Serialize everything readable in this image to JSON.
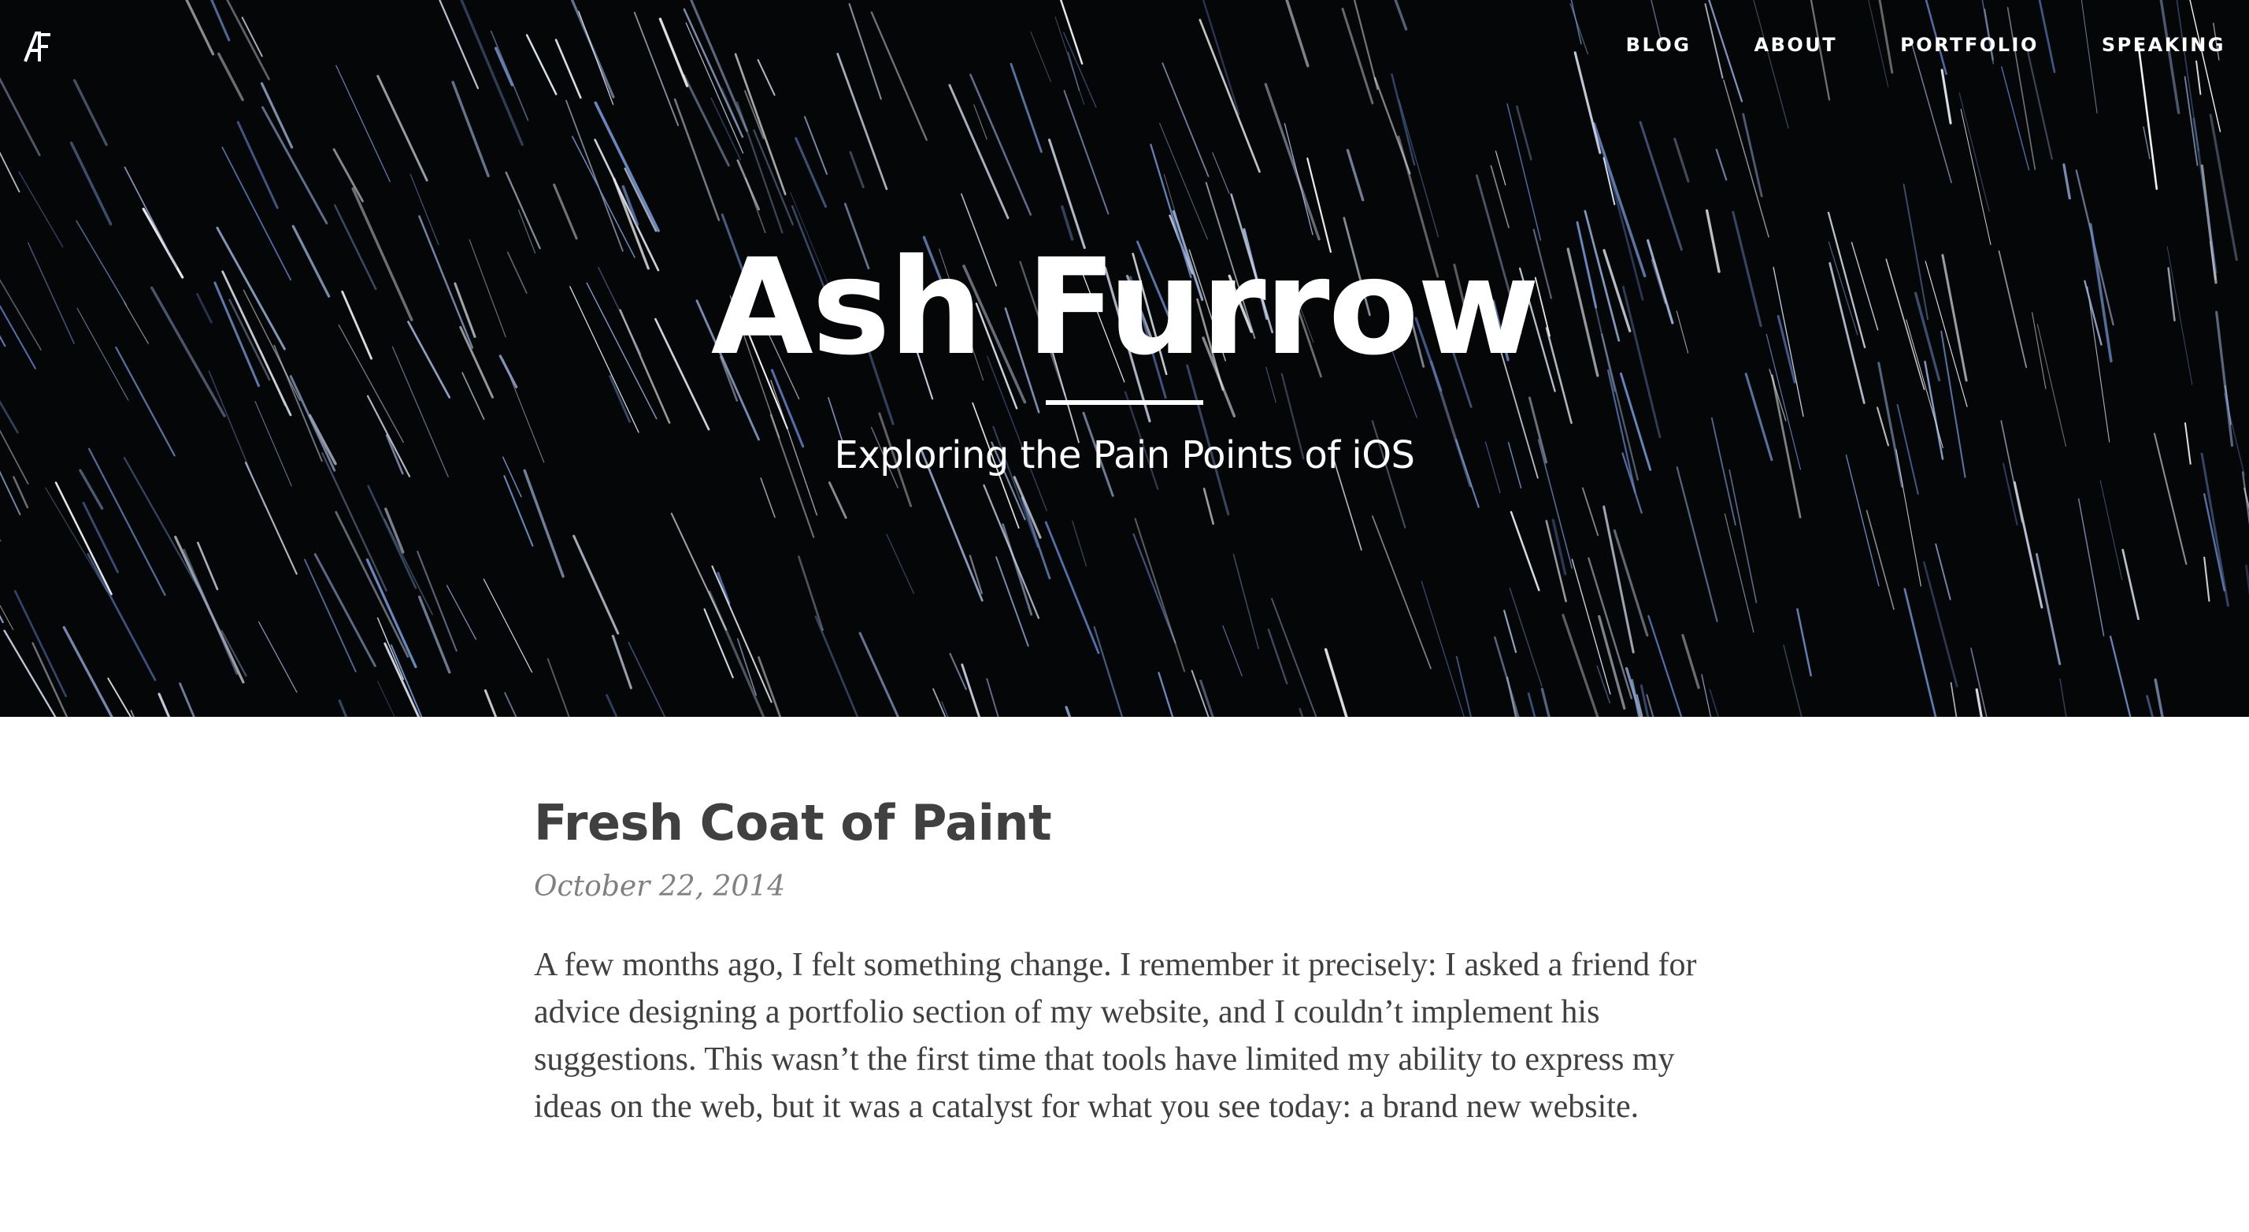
{
  "header": {
    "logo_icon": "af-monogram-icon",
    "nav": [
      {
        "label": "BLOG"
      },
      {
        "label": "ABOUT"
      },
      {
        "label": "PORTFOLIO"
      },
      {
        "label": "SPEAKING"
      }
    ],
    "title": "Ash Furrow",
    "tagline": "Exploring the Pain Points of iOS",
    "background": "star-trails-image"
  },
  "post": {
    "title": "Fresh Coat of Paint",
    "date": "October 22, 2014",
    "body": "A few months ago, I felt something change. I remember it precisely: I asked a friend for advice designing a portfolio section of my website, and I couldn’t implement his suggestions. This wasn’t the first time that tools have limited my ability to express my ideas on the web, but it was a catalyst for what you see today: a brand new website."
  },
  "colors": {
    "hero_background": "#050608",
    "header_text": "#ffffff",
    "post_title": "#404040",
    "post_date": "#808080",
    "post_body": "#404040"
  }
}
